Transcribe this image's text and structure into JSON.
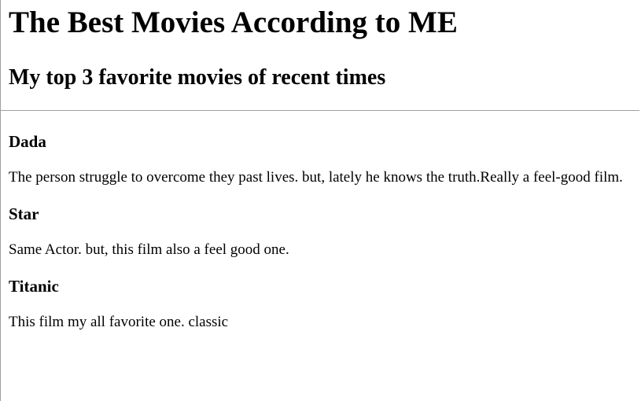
{
  "page": {
    "title": "The Best Movies According to ME",
    "subtitle": "My top 3 favorite movies of recent times"
  },
  "movies": [
    {
      "title": "Dada",
      "description": "The person struggle to overcome they past lives. but, lately he knows the truth.Really a feel-good film."
    },
    {
      "title": "Star",
      "description": "Same Actor. but, this film also a feel good one."
    },
    {
      "title": "Titanic",
      "description": "This film my all favorite one. classic"
    }
  ]
}
